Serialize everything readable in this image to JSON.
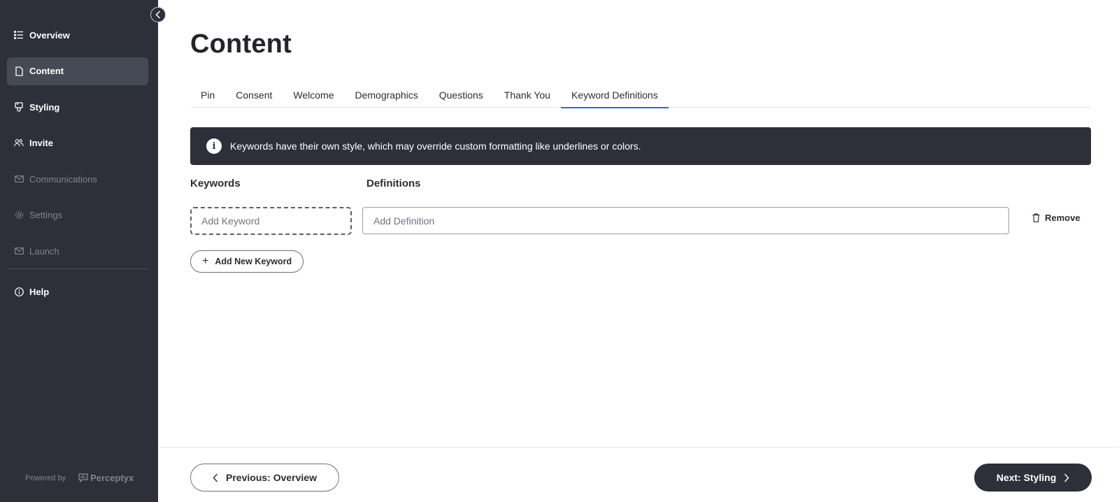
{
  "sidebar": {
    "items": [
      {
        "label": "Overview",
        "icon": "list-icon",
        "state": "normal"
      },
      {
        "label": "Content",
        "icon": "document-icon",
        "state": "active"
      },
      {
        "label": "Styling",
        "icon": "brush-icon",
        "state": "normal"
      },
      {
        "label": "Invite",
        "icon": "users-icon",
        "state": "normal"
      },
      {
        "label": "Communications",
        "icon": "mail-icon",
        "state": "disabled"
      },
      {
        "label": "Settings",
        "icon": "gear-icon",
        "state": "disabled"
      },
      {
        "label": "Launch",
        "icon": "mail-icon",
        "state": "disabled"
      }
    ],
    "help": {
      "label": "Help",
      "icon": "info-circle-icon"
    },
    "powered_by": "Powered by",
    "brand": "Perceptyx"
  },
  "page": {
    "title": "Content"
  },
  "tabs": [
    {
      "label": "Pin",
      "active": false
    },
    {
      "label": "Consent",
      "active": false
    },
    {
      "label": "Welcome",
      "active": false
    },
    {
      "label": "Demographics",
      "active": false
    },
    {
      "label": "Questions",
      "active": false
    },
    {
      "label": "Thank You",
      "active": false
    },
    {
      "label": "Keyword Definitions",
      "active": true
    }
  ],
  "banner": {
    "text": "Keywords have their own style, which may override custom formatting like underlines or colors.",
    "icon": "info-icon"
  },
  "columns": {
    "keywords": "Keywords",
    "definitions": "Definitions"
  },
  "form": {
    "keyword_placeholder": "Add Keyword",
    "definition_placeholder": "Add Definition",
    "keyword_value": "",
    "definition_value": "",
    "remove_label": "Remove",
    "add_label": "Add New Keyword"
  },
  "footer": {
    "prev_label": "Previous: Overview",
    "next_label": "Next: Styling"
  },
  "colors": {
    "sidebar_bg": "#2d3038",
    "active_tab": "#2e6bd1",
    "banner_bg": "#2d3038"
  }
}
